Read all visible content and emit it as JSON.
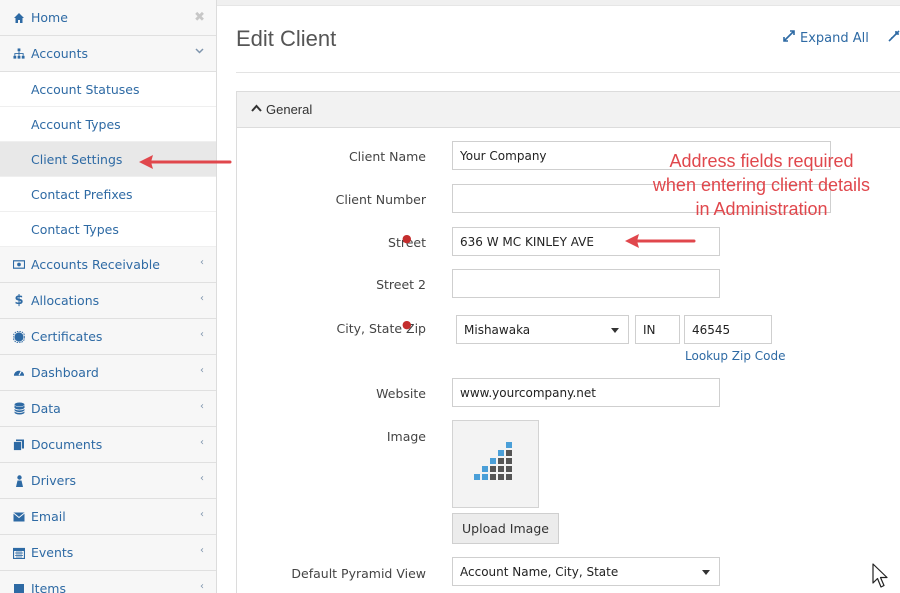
{
  "sidebar": {
    "home": "Home",
    "accounts": "Accounts",
    "accounts_children": [
      "Account Statuses",
      "Account Types",
      "Client Settings",
      "Contact Prefixes",
      "Contact Types"
    ],
    "active_child": "Client Settings",
    "items": [
      "Accounts Receivable",
      "Allocations",
      "Certificates",
      "Dashboard",
      "Data",
      "Documents",
      "Drivers",
      "Email",
      "Events",
      "Items"
    ]
  },
  "header": {
    "title": "Edit Client",
    "expand_all": "Expand All"
  },
  "panel": {
    "title": "General"
  },
  "form": {
    "client_name_label": "Client Name",
    "client_name_value": "Your Company",
    "client_number_label": "Client Number",
    "client_number_value": "",
    "street_label": "Street",
    "street_value": "636 W MC KINLEY AVE",
    "street2_label": "Street 2",
    "street2_value": "",
    "city_state_zip_label": "City, State Zip",
    "city_value": "Mishawaka",
    "state_value": "IN",
    "zip_value": "46545",
    "lookup_zip": "Lookup Zip Code",
    "website_label": "Website",
    "website_value": "www.yourcompany.net",
    "image_label": "Image",
    "upload_image": "Upload Image",
    "pyramid_label": "Default Pyramid View",
    "pyramid_value": "Account Name, City, State"
  },
  "annotation": {
    "line1": "Address fields required",
    "line2": "when entering client details",
    "line3": "in Administration"
  },
  "colors": {
    "link": "#2e6aa4",
    "annotation": "#e0474c",
    "required": "#c42d2d",
    "logo_blue": "#4a9fd8",
    "logo_gray": "#555555"
  }
}
